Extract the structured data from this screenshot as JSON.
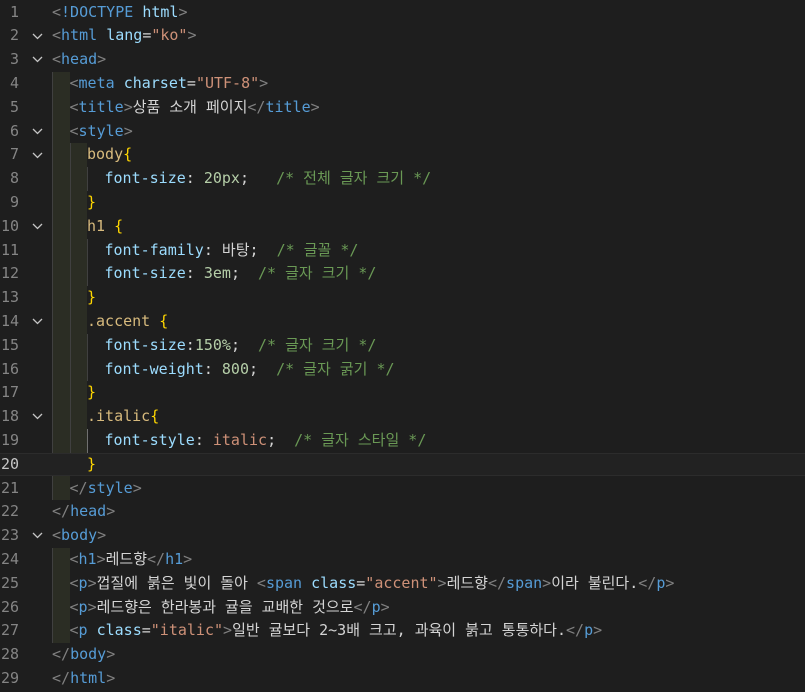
{
  "editor": {
    "language": "html",
    "current_line": 20,
    "fold_icon": "chevron-down-icon",
    "lines": [
      {
        "n": "1",
        "fold": false,
        "indent": 0,
        "tokens": [
          [
            "punct",
            "<"
          ],
          [
            "tag",
            "!DOCTYPE"
          ],
          [
            "text",
            " "
          ],
          [
            "attr",
            "html"
          ],
          [
            "punct",
            ">"
          ]
        ]
      },
      {
        "n": "2",
        "fold": true,
        "indent": 0,
        "tokens": [
          [
            "punct",
            "<"
          ],
          [
            "tag",
            "html"
          ],
          [
            "text",
            " "
          ],
          [
            "attr",
            "lang"
          ],
          [
            "text",
            "="
          ],
          [
            "str",
            "\"ko\""
          ],
          [
            "punct",
            ">"
          ]
        ]
      },
      {
        "n": "3",
        "fold": true,
        "indent": 0,
        "tokens": [
          [
            "punct",
            "<"
          ],
          [
            "tag",
            "head"
          ],
          [
            "punct",
            ">"
          ]
        ]
      },
      {
        "n": "4",
        "fold": false,
        "indent": 1,
        "tokens": [
          [
            "punct",
            "<"
          ],
          [
            "tag",
            "meta"
          ],
          [
            "text",
            " "
          ],
          [
            "attr",
            "charset"
          ],
          [
            "text",
            "="
          ],
          [
            "str",
            "\"UTF-8\""
          ],
          [
            "punct",
            ">"
          ]
        ]
      },
      {
        "n": "5",
        "fold": false,
        "indent": 1,
        "tokens": [
          [
            "punct",
            "<"
          ],
          [
            "tag",
            "title"
          ],
          [
            "punct",
            ">"
          ],
          [
            "text",
            "상품 소개 페이지"
          ],
          [
            "punct",
            "</"
          ],
          [
            "tag",
            "title"
          ],
          [
            "punct",
            ">"
          ]
        ]
      },
      {
        "n": "6",
        "fold": true,
        "indent": 1,
        "tokens": [
          [
            "punct",
            "<"
          ],
          [
            "tag",
            "style"
          ],
          [
            "punct",
            ">"
          ]
        ]
      },
      {
        "n": "7",
        "fold": true,
        "indent": 2,
        "tokens": [
          [
            "sel",
            "body"
          ],
          [
            "brace",
            "{"
          ]
        ]
      },
      {
        "n": "8",
        "fold": false,
        "indent": 3,
        "tokens": [
          [
            "prop",
            "font-size"
          ],
          [
            "text",
            ": "
          ],
          [
            "num",
            "20px"
          ],
          [
            "text",
            ";   "
          ],
          [
            "comment",
            "/* 전체 글자 크기 */"
          ]
        ]
      },
      {
        "n": "9",
        "fold": false,
        "indent": 2,
        "tokens": [
          [
            "brace",
            "}"
          ]
        ]
      },
      {
        "n": "10",
        "fold": true,
        "indent": 2,
        "tokens": [
          [
            "sel",
            "h1"
          ],
          [
            "text",
            " "
          ],
          [
            "brace",
            "{"
          ]
        ]
      },
      {
        "n": "11",
        "fold": false,
        "indent": 3,
        "tokens": [
          [
            "prop",
            "font-family"
          ],
          [
            "text",
            ": "
          ],
          [
            "text",
            "바탕"
          ],
          [
            "text",
            ";  "
          ],
          [
            "comment",
            "/* 글꼴 */"
          ]
        ]
      },
      {
        "n": "12",
        "fold": false,
        "indent": 3,
        "tokens": [
          [
            "prop",
            "font-size"
          ],
          [
            "text",
            ": "
          ],
          [
            "num",
            "3em"
          ],
          [
            "text",
            ";  "
          ],
          [
            "comment",
            "/* 글자 크기 */"
          ]
        ]
      },
      {
        "n": "13",
        "fold": false,
        "indent": 2,
        "tokens": [
          [
            "brace",
            "}"
          ]
        ]
      },
      {
        "n": "14",
        "fold": true,
        "indent": 2,
        "tokens": [
          [
            "sel",
            ".accent"
          ],
          [
            "text",
            " "
          ],
          [
            "brace",
            "{"
          ]
        ]
      },
      {
        "n": "15",
        "fold": false,
        "indent": 3,
        "tokens": [
          [
            "prop",
            "font-size"
          ],
          [
            "text",
            ":"
          ],
          [
            "num",
            "150%"
          ],
          [
            "text",
            ";  "
          ],
          [
            "comment",
            "/* 글자 크기 */"
          ]
        ]
      },
      {
        "n": "16",
        "fold": false,
        "indent": 3,
        "tokens": [
          [
            "prop",
            "font-weight"
          ],
          [
            "text",
            ": "
          ],
          [
            "num",
            "800"
          ],
          [
            "text",
            ";  "
          ],
          [
            "comment",
            "/* 글자 굵기 */"
          ]
        ]
      },
      {
        "n": "17",
        "fold": false,
        "indent": 2,
        "tokens": [
          [
            "brace",
            "}"
          ]
        ]
      },
      {
        "n": "18",
        "fold": true,
        "indent": 2,
        "tokens": [
          [
            "sel",
            ".italic"
          ],
          [
            "brace",
            "{"
          ]
        ]
      },
      {
        "n": "19",
        "fold": false,
        "indent": 3,
        "tokens": [
          [
            "prop",
            "font-style"
          ],
          [
            "text",
            ": "
          ],
          [
            "val",
            "italic"
          ],
          [
            "text",
            ";  "
          ],
          [
            "comment",
            "/* 글자 스타일 */"
          ]
        ]
      },
      {
        "n": "20",
        "fold": false,
        "indent": 2,
        "tokens": [
          [
            "brace",
            "}"
          ]
        ]
      },
      {
        "n": "21",
        "fold": false,
        "indent": 1,
        "tokens": [
          [
            "punct",
            "</"
          ],
          [
            "tag",
            "style"
          ],
          [
            "punct",
            ">"
          ]
        ]
      },
      {
        "n": "22",
        "fold": false,
        "indent": 0,
        "tokens": [
          [
            "punct",
            "</"
          ],
          [
            "tag",
            "head"
          ],
          [
            "punct",
            ">"
          ]
        ]
      },
      {
        "n": "23",
        "fold": true,
        "indent": 0,
        "tokens": [
          [
            "punct",
            "<"
          ],
          [
            "tag",
            "body"
          ],
          [
            "punct",
            ">"
          ]
        ]
      },
      {
        "n": "24",
        "fold": false,
        "indent": 1,
        "tokens": [
          [
            "punct",
            "<"
          ],
          [
            "tag",
            "h1"
          ],
          [
            "punct",
            ">"
          ],
          [
            "text",
            "레드향"
          ],
          [
            "punct",
            "</"
          ],
          [
            "tag",
            "h1"
          ],
          [
            "punct",
            ">"
          ]
        ]
      },
      {
        "n": "25",
        "fold": false,
        "indent": 1,
        "tokens": [
          [
            "punct",
            "<"
          ],
          [
            "tag",
            "p"
          ],
          [
            "punct",
            ">"
          ],
          [
            "text",
            "껍질에 붉은 빛이 돌아 "
          ],
          [
            "punct",
            "<"
          ],
          [
            "tag",
            "span"
          ],
          [
            "text",
            " "
          ],
          [
            "attr",
            "class"
          ],
          [
            "text",
            "="
          ],
          [
            "str",
            "\"accent\""
          ],
          [
            "punct",
            ">"
          ],
          [
            "text",
            "레드향"
          ],
          [
            "punct",
            "</"
          ],
          [
            "tag",
            "span"
          ],
          [
            "punct",
            ">"
          ],
          [
            "text",
            "이라 불린다."
          ],
          [
            "punct",
            "</"
          ],
          [
            "tag",
            "p"
          ],
          [
            "punct",
            ">"
          ]
        ]
      },
      {
        "n": "26",
        "fold": false,
        "indent": 1,
        "tokens": [
          [
            "punct",
            "<"
          ],
          [
            "tag",
            "p"
          ],
          [
            "punct",
            ">"
          ],
          [
            "text",
            "레드향은 한라봉과 귤을 교배한 것으로"
          ],
          [
            "punct",
            "</"
          ],
          [
            "tag",
            "p"
          ],
          [
            "punct",
            ">"
          ]
        ]
      },
      {
        "n": "27",
        "fold": false,
        "indent": 1,
        "tokens": [
          [
            "punct",
            "<"
          ],
          [
            "tag",
            "p"
          ],
          [
            "text",
            " "
          ],
          [
            "attr",
            "class"
          ],
          [
            "text",
            "="
          ],
          [
            "str",
            "\"italic\""
          ],
          [
            "punct",
            ">"
          ],
          [
            "text",
            "일반 귤보다 2~3배 크고, 과육이 붉고 통통하다."
          ],
          [
            "punct",
            "</"
          ],
          [
            "tag",
            "p"
          ],
          [
            "punct",
            ">"
          ]
        ]
      },
      {
        "n": "28",
        "fold": false,
        "indent": 0,
        "tokens": [
          [
            "punct",
            "</"
          ],
          [
            "tag",
            "body"
          ],
          [
            "punct",
            ">"
          ]
        ]
      },
      {
        "n": "29",
        "fold": false,
        "indent": 0,
        "tokens": [
          [
            "punct",
            "</"
          ],
          [
            "tag",
            "html"
          ],
          [
            "punct",
            ">"
          ]
        ]
      }
    ]
  }
}
